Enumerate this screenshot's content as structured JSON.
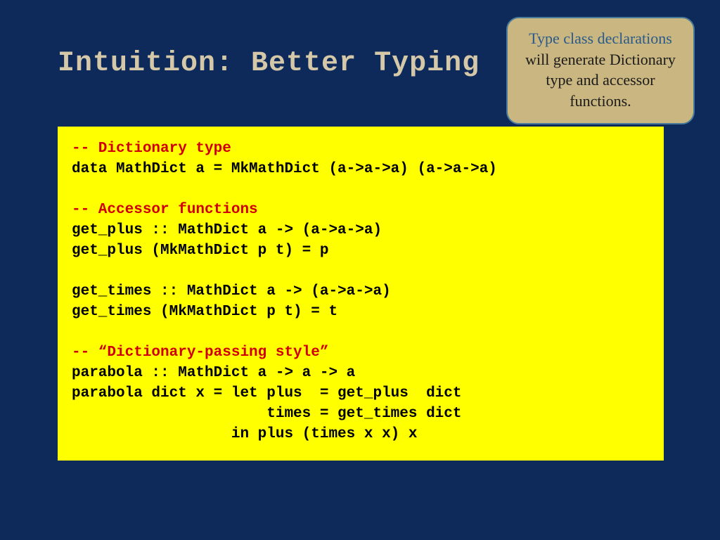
{
  "title": "Intuition: Better Typing",
  "callout": {
    "em1": "Type class",
    "em2": "declarations",
    "rest": " will generate Dictionary type and accessor functions."
  },
  "code": {
    "c1": "-- Dictionary type",
    "l1": "data MathDict a = MkMathDict (a->a->a) (a->a->a)",
    "c2": "-- Accessor functions",
    "l2": "get_plus :: MathDict a -> (a->a->a)",
    "l3": "get_plus (MkMathDict p t) = p",
    "l4": "get_times :: MathDict a -> (a->a->a)",
    "l5": "get_times (MkMathDict p t) = t",
    "c3": "-- “Dictionary-passing style”",
    "l6": "parabola :: MathDict a -> a -> a",
    "l7": "parabola dict x = let plus  = get_plus  dict",
    "l8": "                      times = get_times dict",
    "l9": "                  in plus (times x x) x"
  }
}
